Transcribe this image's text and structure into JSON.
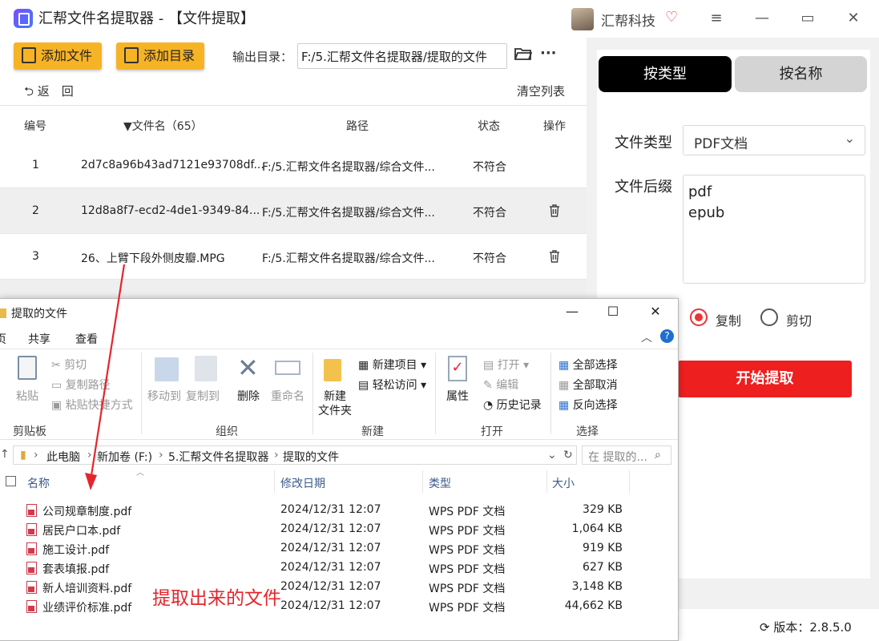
{
  "titlebar": {
    "app_title": "汇帮文件名提取器 - 【文件提取】",
    "company": "汇帮科技",
    "vip_icon": "diamond-icon",
    "menu_icon": "≡",
    "minimize_icon": "—",
    "maximize_icon": "▭",
    "close_icon": "✕"
  },
  "toolbar": {
    "add_file": "添加文件",
    "add_folder": "添加目录",
    "output_label": "输出目录：",
    "output_value": "F:/5.汇帮文件名提取器/提取的文件",
    "more": "···",
    "back": "返　回",
    "clear_list": "清空列表"
  },
  "table": {
    "headers": {
      "id": "编号",
      "name": "文件名（65）",
      "path": "路径",
      "status": "状态",
      "action": "操作"
    },
    "rows": [
      {
        "id": "1",
        "name": "2d7c8a96b43ad7121e93708df...",
        "path": "F:/5.汇帮文件名提取器/综合文件...",
        "status": "不符合"
      },
      {
        "id": "2",
        "name": "12d8a8f7-ecd2-4de1-9349-84...",
        "path": "F:/5.汇帮文件名提取器/综合文件...",
        "status": "不符合"
      },
      {
        "id": "3",
        "name": "26、上臂下段外侧皮瓣.MPG",
        "path": "F:/5.汇帮文件名提取器/综合文件...",
        "status": "不符合"
      }
    ]
  },
  "right": {
    "tab_by_type": "按类型",
    "tab_by_name": "按名称",
    "file_type_label": "文件类型",
    "file_type_value": "PDF文档",
    "suffix_label": "文件后缀",
    "suffixes": [
      "pdf",
      "epub"
    ],
    "radio_copy": "复制",
    "radio_cut": "剪切",
    "start_button": "开始提取",
    "version": "版本：2.8.5.0",
    "selected_mode": "copy"
  },
  "explorer": {
    "title": "提取的文件",
    "minimize": "—",
    "maximize": "☐",
    "close": "✕",
    "tabs": [
      "页",
      "共享",
      "查看"
    ],
    "ribbon": {
      "clipboard": {
        "paste": "粘贴",
        "cut": "剪切",
        "copy_path": "复制路径",
        "paste_shortcut": "粘贴快捷方式",
        "group": "剪贴板"
      },
      "organize": {
        "move_to": "移动到",
        "copy_to": "复制到",
        "delete": "删除",
        "rename": "重命名",
        "group": "组织"
      },
      "new": {
        "new_folder_1": "新建",
        "new_folder_2": "文件夹",
        "new_item": "新建项目",
        "easy_access": "轻松访问",
        "group": "新建"
      },
      "open": {
        "properties": "属性",
        "open": "打开",
        "edit": "编辑",
        "history": "历史记录",
        "group": "打开"
      },
      "select": {
        "select_all": "全部选择",
        "select_none": "全部取消",
        "invert": "反向选择",
        "group": "选择"
      }
    },
    "address": [
      "此电脑",
      "新加卷 (F:)",
      "5.汇帮文件名提取器",
      "提取的文件"
    ],
    "search_placeholder": "在 提取的...",
    "columns": {
      "name": "名称",
      "modified": "修改日期",
      "type": "类型",
      "size": "大小"
    },
    "files": [
      {
        "name": "公司规章制度.pdf",
        "modified": "2024/12/31 12:07",
        "type": "WPS PDF 文档",
        "size": "329 KB"
      },
      {
        "name": "居民户口本.pdf",
        "modified": "2024/12/31 12:07",
        "type": "WPS PDF 文档",
        "size": "1,064 KB"
      },
      {
        "name": "施工设计.pdf",
        "modified": "2024/12/31 12:07",
        "type": "WPS PDF 文档",
        "size": "919 KB"
      },
      {
        "name": "套表填报.pdf",
        "modified": "2024/12/31 12:07",
        "type": "WPS PDF 文档",
        "size": "627 KB"
      },
      {
        "name": "新人培训资料.pdf",
        "modified": "2024/12/31 12:07",
        "type": "WPS PDF 文档",
        "size": "3,148 KB"
      },
      {
        "name": "业绩评价标准.pdf",
        "modified": "2024/12/31 12:07",
        "type": "WPS PDF 文档",
        "size": "44,662 KB"
      }
    ]
  },
  "annotation": {
    "text": "提取出来的文件",
    "color": "#e5252b"
  },
  "colors": {
    "accent_orange": "#f7b326",
    "start_red": "#ee1f1f",
    "tab_active": "#000000"
  }
}
